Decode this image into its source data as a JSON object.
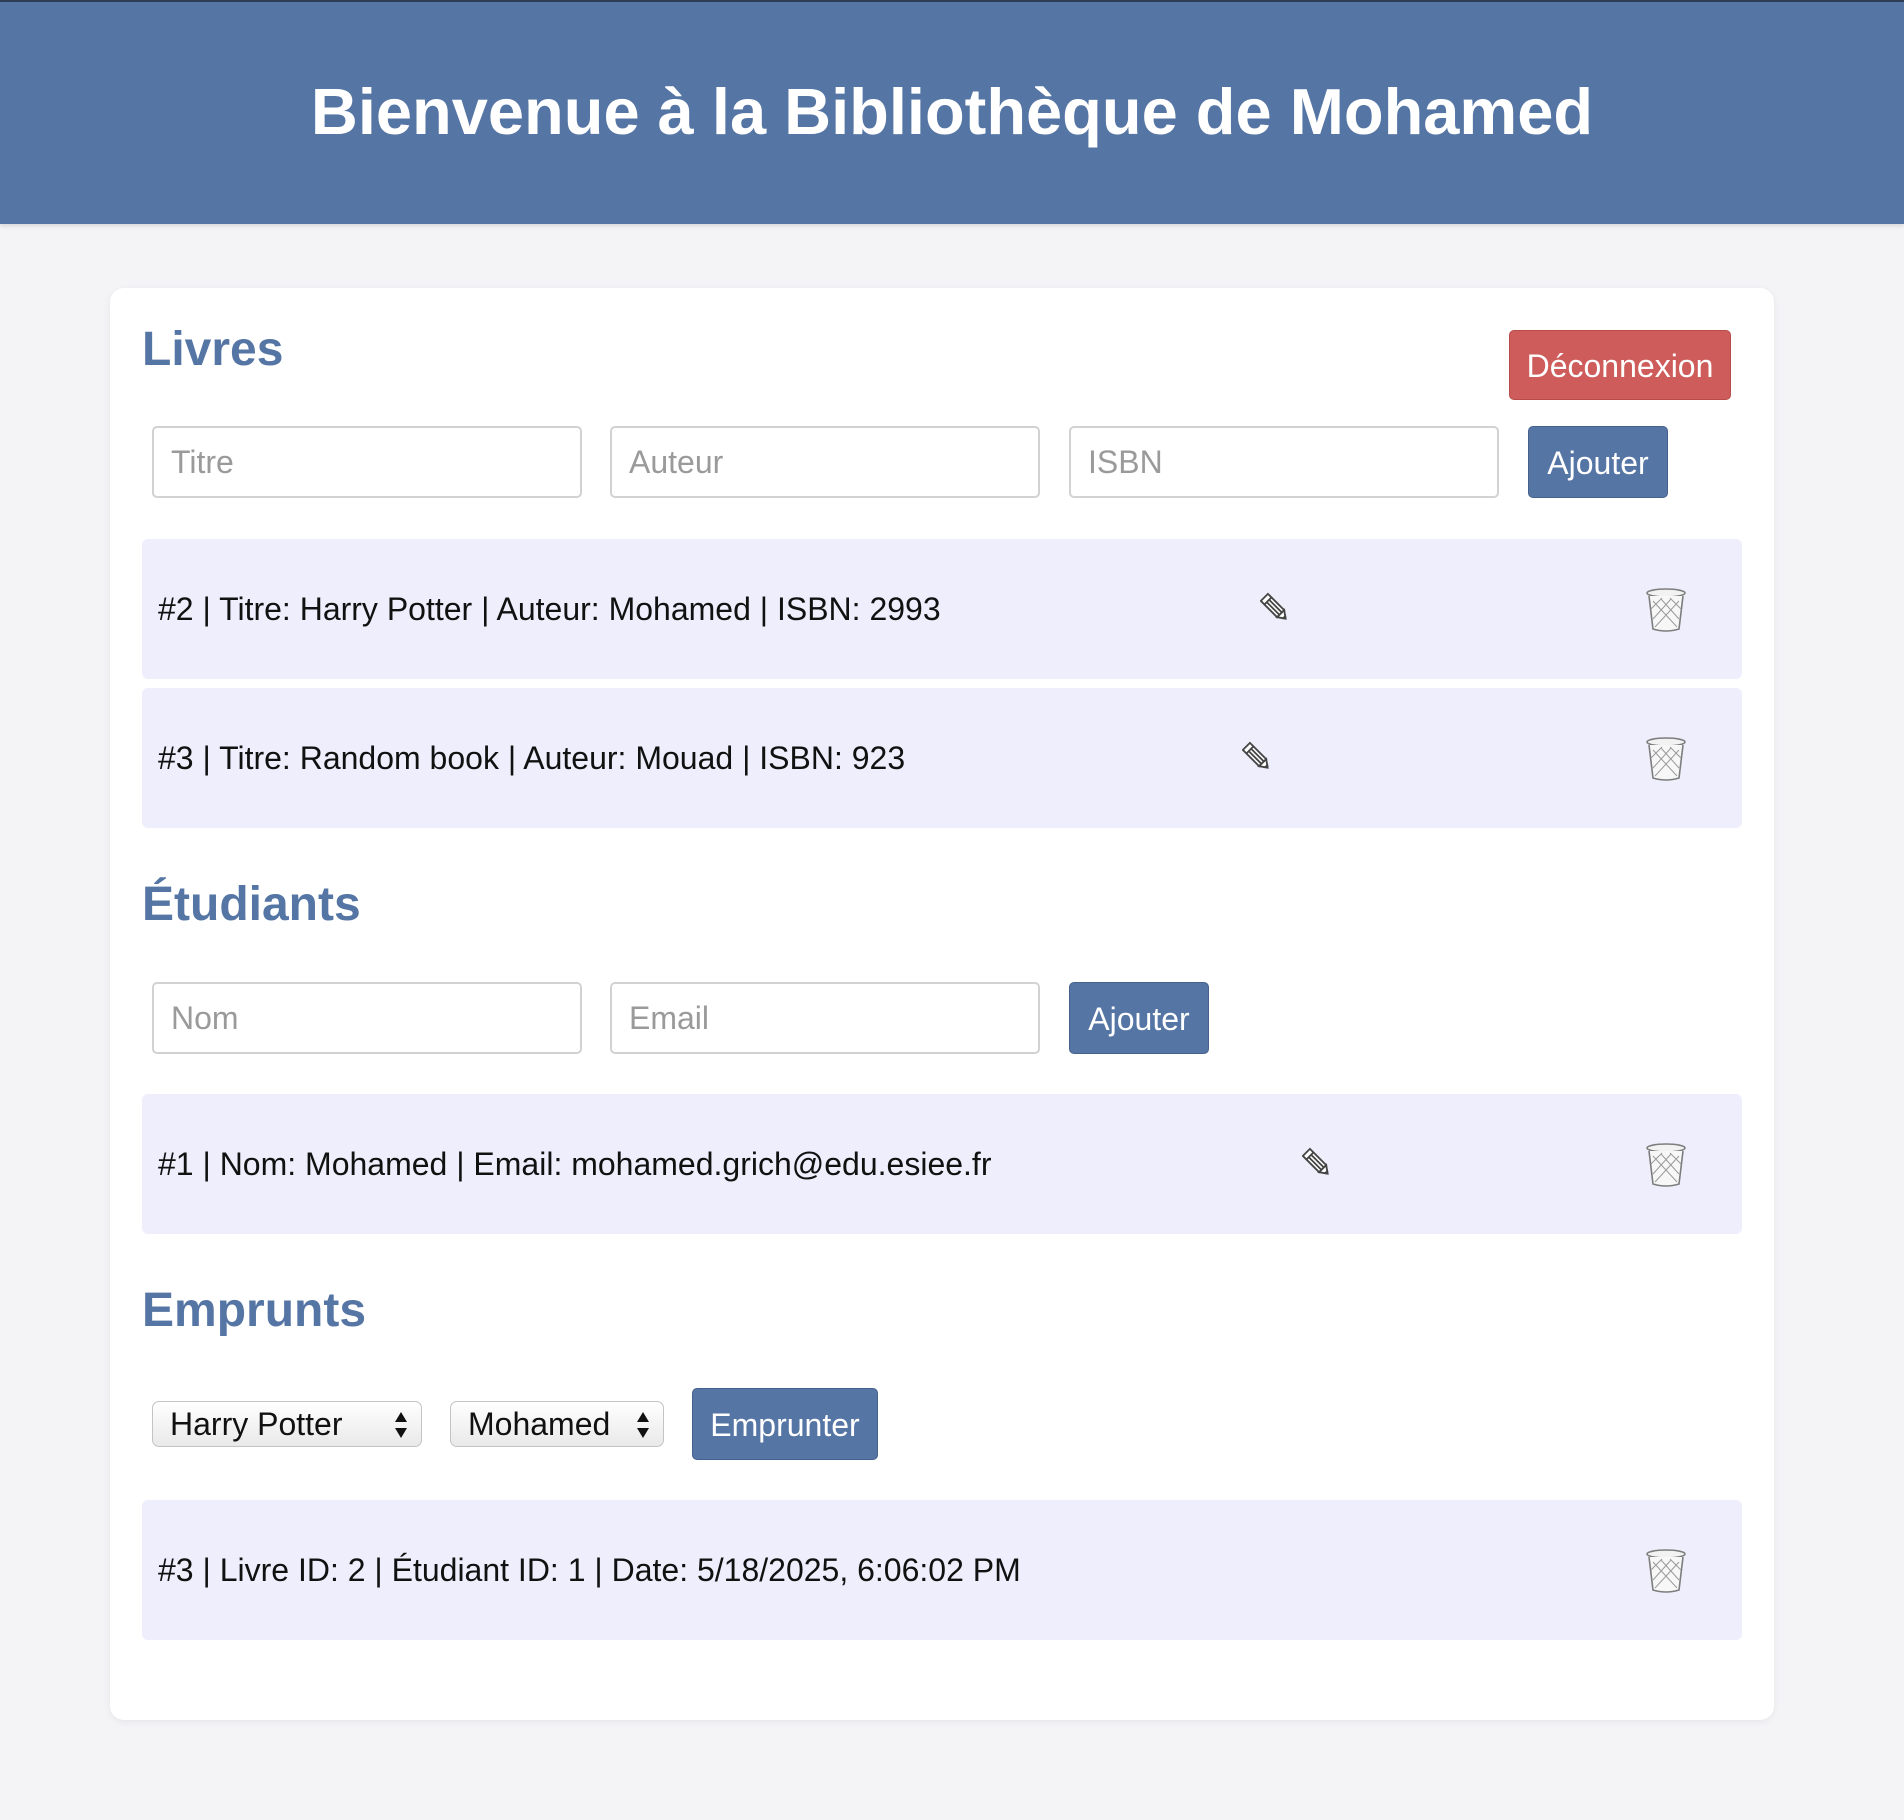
{
  "header": {
    "title": "Bienvenue à la Bibliothèque de Mohamed"
  },
  "logout_label": "Déconnexion",
  "books": {
    "title": "Livres",
    "inputs": {
      "title_placeholder": "Titre",
      "author_placeholder": "Auteur",
      "isbn_placeholder": "ISBN"
    },
    "add_label": "Ajouter",
    "items": [
      {
        "text": "#2 | Titre: Harry Potter | Auteur: Mohamed | ISBN: 2993"
      },
      {
        "text": "#3 | Titre: Random book | Auteur: Mouad | ISBN: 923"
      }
    ]
  },
  "students": {
    "title": "Étudiants",
    "inputs": {
      "name_placeholder": "Nom",
      "email_placeholder": "Email"
    },
    "add_label": "Ajouter",
    "items": [
      {
        "text": "#1 | Nom: Mohamed | Email: mohamed.grich@edu.esiee.fr"
      }
    ]
  },
  "loans": {
    "title": "Emprunts",
    "book_select": {
      "selected": "Harry Potter"
    },
    "student_select": {
      "selected": "Mohamed"
    },
    "borrow_label": "Emprunter",
    "items": [
      {
        "text": "#3 | Livre ID: 2 | Étudiant ID: 1 | Date: 5/18/2025, 6:06:02 PM"
      }
    ]
  },
  "colors": {
    "accent": "#5575a4",
    "danger": "#cd5c5a",
    "row_background": "#eeeefc",
    "page_background": "#f4f4f7"
  },
  "icons": {
    "edit": "pencil-icon",
    "delete": "trash-icon",
    "select": "up-down-arrows-icon"
  }
}
